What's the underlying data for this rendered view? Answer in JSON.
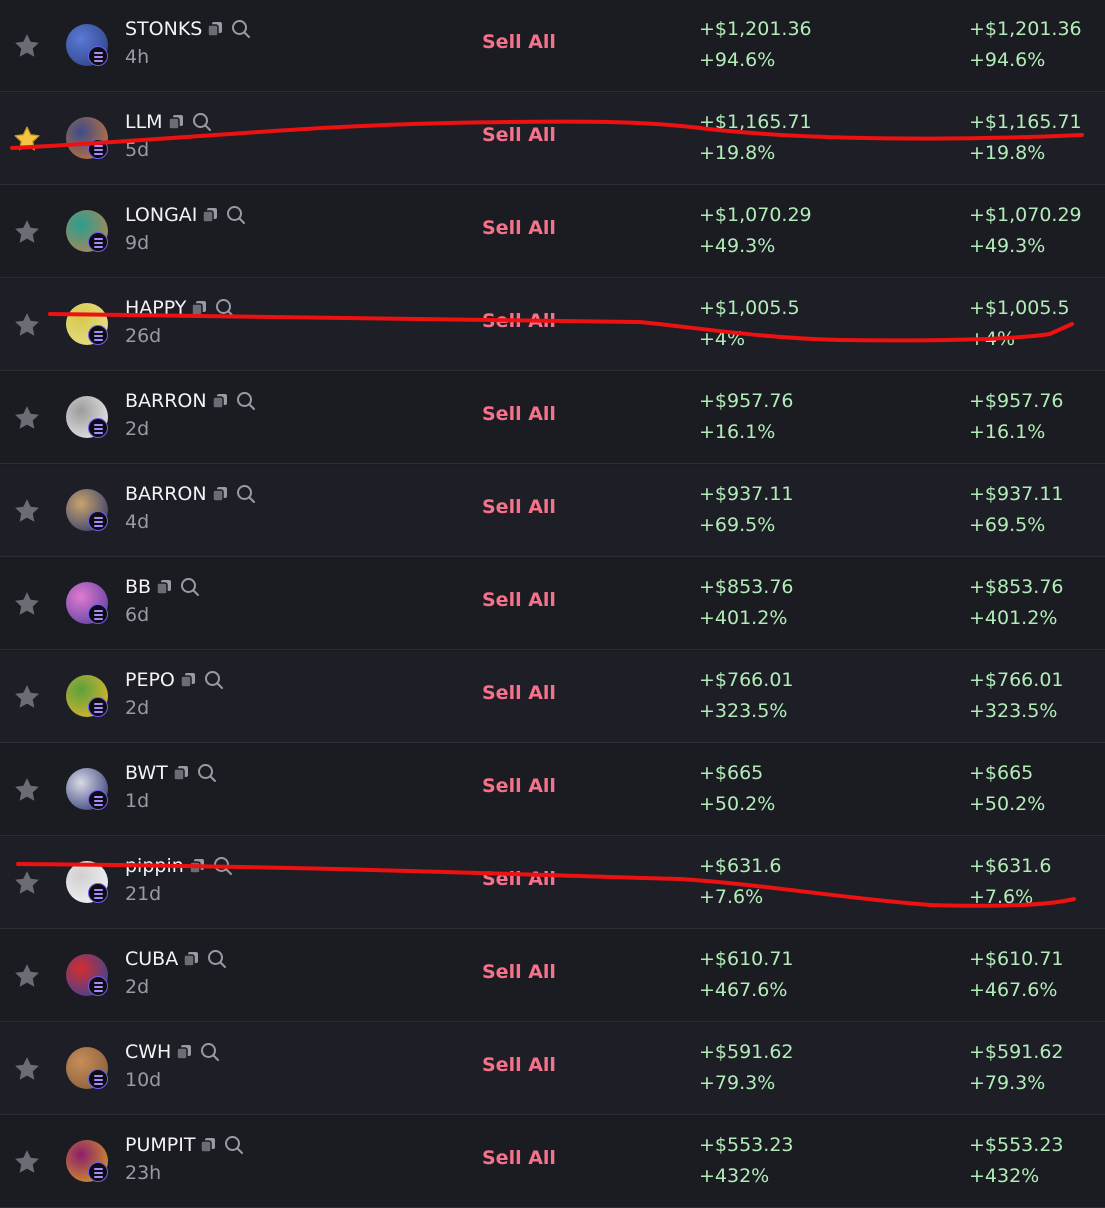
{
  "actions": {
    "sell_label": "Sell All"
  },
  "colors": {
    "profit": "#b2ecb8",
    "sell": "#f6728a",
    "star_active": "#f5c542",
    "star_inactive": "#6b6c75",
    "annotation": "#ee1111"
  },
  "tokens": [
    {
      "name": "STONKS",
      "age": "4h",
      "pnl": "+$1,201.36",
      "pct": "+94.6%",
      "starred": false,
      "avatar": [
        "#2a3b7a",
        "#5a7ad6"
      ]
    },
    {
      "name": "LLM",
      "age": "5d",
      "pnl": "+$1,165.71",
      "pct": "+19.8%",
      "starred": true,
      "avatar": [
        "#d97a2a",
        "#3b4c8a"
      ]
    },
    {
      "name": "LONGAI",
      "age": "9d",
      "pnl": "+$1,070.29",
      "pct": "+49.3%",
      "starred": false,
      "avatar": [
        "#c7844b",
        "#2a9d8f"
      ]
    },
    {
      "name": "HAPPY",
      "age": "26d",
      "pnl": "+$1,005.5",
      "pct": "+4%",
      "starred": false,
      "avatar": [
        "#e8e29a",
        "#d6c84a"
      ]
    },
    {
      "name": "BARRON",
      "age": "2d",
      "pnl": "+$957.76",
      "pct": "+16.1%",
      "starred": false,
      "avatar": [
        "#f2f2f2",
        "#9c9c9c"
      ]
    },
    {
      "name": "BARRON",
      "age": "4d",
      "pnl": "+$937.11",
      "pct": "+69.5%",
      "starred": false,
      "avatar": [
        "#203070",
        "#c9a36b"
      ]
    },
    {
      "name": "BB",
      "age": "6d",
      "pnl": "+$853.76",
      "pct": "+401.2%",
      "starred": false,
      "avatar": [
        "#4b3a9a",
        "#e07ad0"
      ]
    },
    {
      "name": "PEPO",
      "age": "2d",
      "pnl": "+$766.01",
      "pct": "+323.5%",
      "starred": false,
      "avatar": [
        "#f2b92c",
        "#5aa03c"
      ]
    },
    {
      "name": "BWT",
      "age": "1d",
      "pnl": "+$665",
      "pct": "+50.2%",
      "starred": false,
      "avatar": [
        "#1f2a6a",
        "#d9d9e6"
      ]
    },
    {
      "name": "pippin",
      "age": "21d",
      "pnl": "+$631.6",
      "pct": "+7.6%",
      "starred": false,
      "avatar": [
        "#f7f7f7",
        "#d0d0d0"
      ]
    },
    {
      "name": "CUBA",
      "age": "2d",
      "pnl": "+$610.71",
      "pct": "+467.6%",
      "starred": false,
      "avatar": [
        "#2147a8",
        "#d62d2d"
      ]
    },
    {
      "name": "CWH",
      "age": "10d",
      "pnl": "+$591.62",
      "pct": "+79.3%",
      "starred": false,
      "avatar": [
        "#7a5a3a",
        "#c98c58"
      ]
    },
    {
      "name": "PUMPIT",
      "age": "23h",
      "pnl": "+$553.23",
      "pct": "+432%",
      "starred": false,
      "avatar": [
        "#e0a81c",
        "#8b1e6e"
      ]
    }
  ]
}
